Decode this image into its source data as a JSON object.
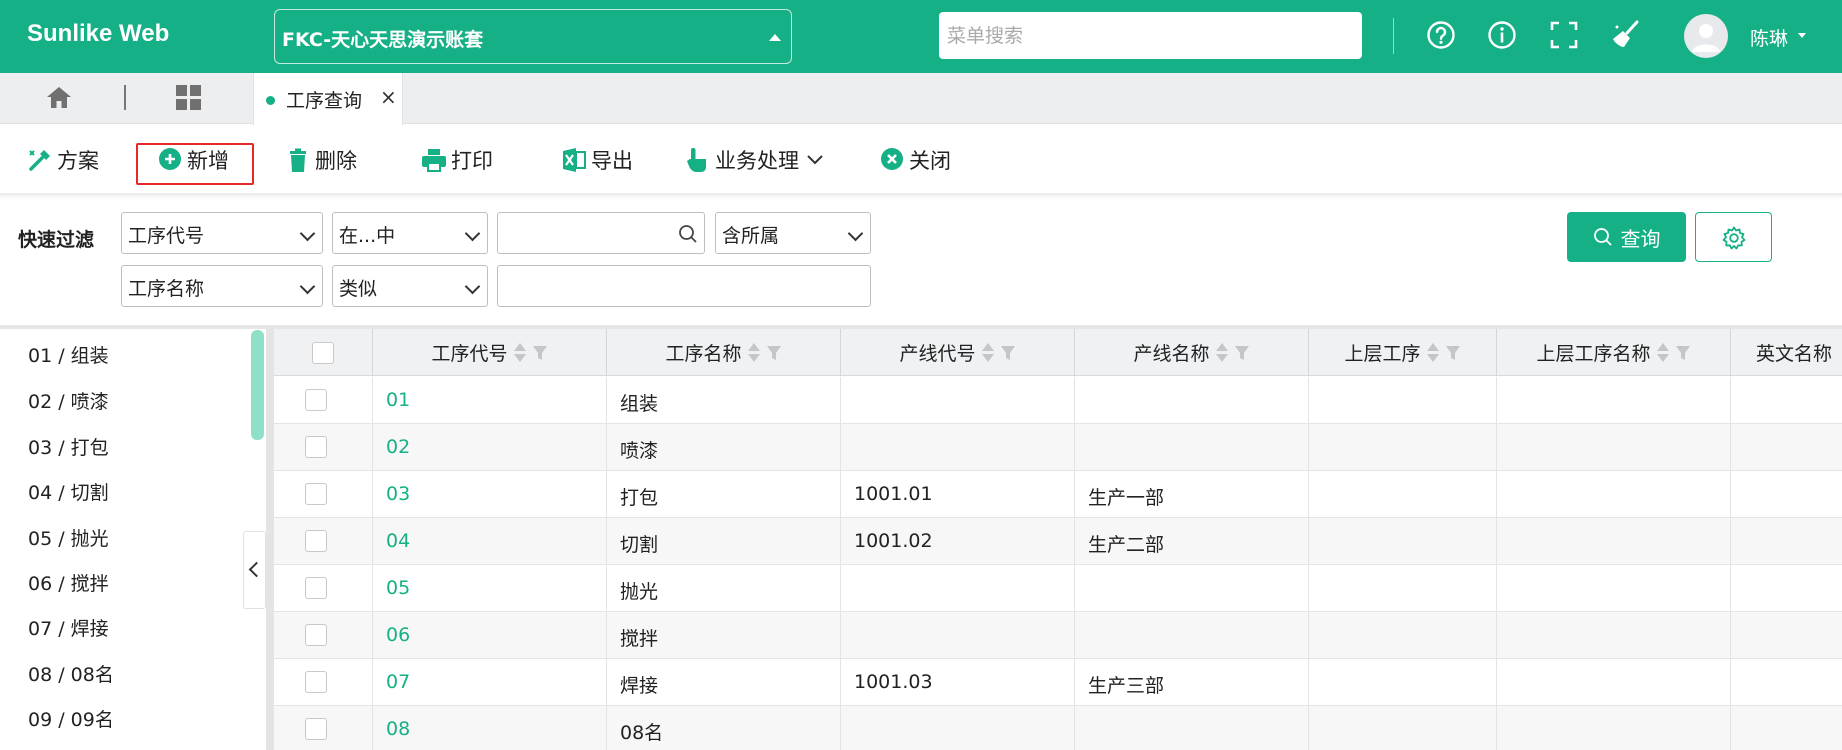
{
  "app": {
    "brand": "Sunlike Web",
    "account": "FKC-天心天思演示账套",
    "search_placeholder": "菜单搜索",
    "user_name": "陈琳",
    "accent_color": "#16b086"
  },
  "topbar_icons": [
    "help-icon",
    "info-icon",
    "fullscreen-icon",
    "broom-icon",
    "user-avatar-icon"
  ],
  "tabs": {
    "home_icon": "home-icon",
    "apps_icon": "grid-icon",
    "active_tab": "工序查询"
  },
  "toolbar": {
    "scheme": "方案",
    "add": "新增",
    "delete": "删除",
    "print": "打印",
    "export": "导出",
    "business": "业务处理",
    "close": "关闭"
  },
  "filter": {
    "label": "快速过滤",
    "row1": {
      "field": "工序代号",
      "op": "在...中",
      "value": "",
      "scope": "含所属"
    },
    "row2": {
      "field": "工序名称",
      "op": "类似",
      "value": ""
    },
    "query_button": "查询"
  },
  "tree": [
    "01 / 组装",
    "02 / 喷漆",
    "03 / 打包",
    "04 / 切割",
    "05 / 抛光",
    "06 / 搅拌",
    "07 / 焊接",
    "08 / 08名",
    "09 / 09名"
  ],
  "grid": {
    "columns": [
      "工序代号",
      "工序名称",
      "产线代号",
      "产线名称",
      "上层工序",
      "上层工序名称",
      "英文名称"
    ],
    "rows": [
      [
        "01",
        "组装",
        "",
        "",
        "",
        "",
        ""
      ],
      [
        "02",
        "喷漆",
        "",
        "",
        "",
        "",
        ""
      ],
      [
        "03",
        "打包",
        "1001.01",
        "生产一部",
        "",
        "",
        ""
      ],
      [
        "04",
        "切割",
        "1001.02",
        "生产二部",
        "",
        "",
        ""
      ],
      [
        "05",
        "抛光",
        "",
        "",
        "",
        "",
        ""
      ],
      [
        "06",
        "搅拌",
        "",
        "",
        "",
        "",
        ""
      ],
      [
        "07",
        "焊接",
        "1001.03",
        "生产三部",
        "",
        "",
        ""
      ],
      [
        "08",
        "08名",
        "",
        "",
        "",
        "",
        ""
      ]
    ]
  }
}
